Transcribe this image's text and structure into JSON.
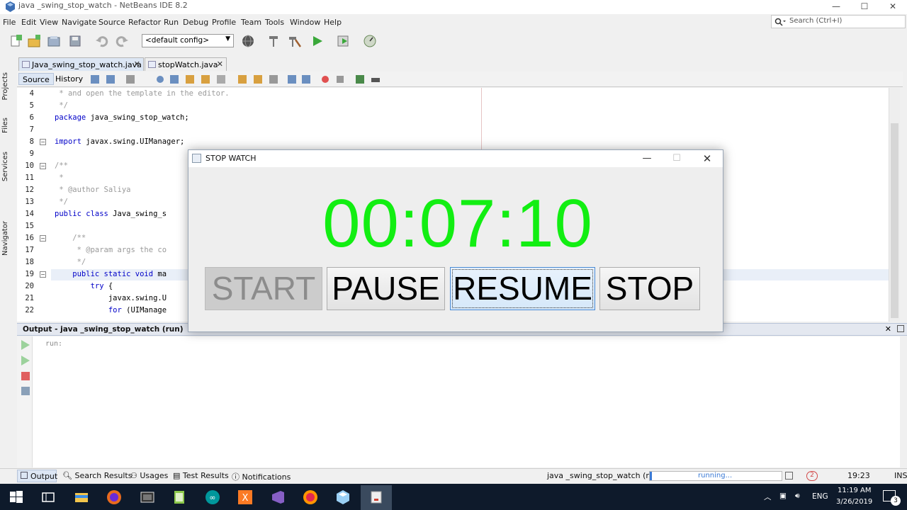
{
  "window": {
    "title": "java _swing_stop_watch - NetBeans IDE 8.2",
    "minimize": "—",
    "maximize": "☐",
    "close": "✕"
  },
  "menu": [
    "File",
    "Edit",
    "View",
    "Navigate",
    "Source",
    "Refactor",
    "Run",
    "Debug",
    "Profile",
    "Team",
    "Tools",
    "Window",
    "Help"
  ],
  "search": {
    "placeholder": "Search (Ctrl+I)"
  },
  "toolbar": {
    "config": "<default config>"
  },
  "side_tabs": [
    "Projects",
    "Files",
    "Services",
    "Navigator"
  ],
  "editor_tabs": [
    {
      "label": "Java_swing_stop_watch.java"
    },
    {
      "label": "stopWatch.java"
    }
  ],
  "source_tabs": {
    "source": "Source",
    "history": "History"
  },
  "code_lines": [
    {
      "n": "4",
      "text": " * and open the template in the editor.",
      "cls": "cmt"
    },
    {
      "n": "5",
      "text": " */",
      "cls": "cmt"
    },
    {
      "n": "6",
      "kw": "package",
      "text": " java_swing_stop_watch;"
    },
    {
      "n": "7",
      "text": ""
    },
    {
      "n": "8",
      "kw": "import",
      "text": " javax.swing.UIManager;"
    },
    {
      "n": "9",
      "text": ""
    },
    {
      "n": "10",
      "text": "/**",
      "cls": "cmt"
    },
    {
      "n": "11",
      "text": " *",
      "cls": "cmt"
    },
    {
      "n": "12",
      "text": " * @author Saliya",
      "cls": "cmt"
    },
    {
      "n": "13",
      "text": " */",
      "cls": "cmt"
    },
    {
      "n": "14",
      "kw": "public class",
      "text": " Java_swing_s"
    },
    {
      "n": "15",
      "text": ""
    },
    {
      "n": "16",
      "text": "    /**",
      "cls": "cmt"
    },
    {
      "n": "17",
      "text": "     * @param args the co",
      "cls": "cmt"
    },
    {
      "n": "18",
      "text": "     */",
      "cls": "cmt"
    },
    {
      "n": "19",
      "kw": "    public static void",
      "text": " ma"
    },
    {
      "n": "20",
      "kw": "        try",
      "text": " {"
    },
    {
      "n": "21",
      "text": "            javax.swing.U"
    },
    {
      "n": "22",
      "kw": "            for",
      "text": " (UIManage"
    }
  ],
  "output": {
    "header": "Output - java _swing_stop_watch (run)",
    "text": "run:",
    "close": "✕"
  },
  "status": {
    "tabs": [
      "Output",
      "Search Results",
      "Usages",
      "Test Results",
      "Notifications"
    ],
    "run_label": "java _swing_stop_watch (run)",
    "running": "running...",
    "position": "19:23",
    "ins": "INS",
    "errors": "2"
  },
  "taskbar": {
    "lang": "ENG",
    "time": "11:19 AM",
    "date": "3/26/2019",
    "notif": "3"
  },
  "stopwatch": {
    "title": "STOP WATCH",
    "display": "00:07:10",
    "start": "START",
    "pause": "PAUSE",
    "resume": "RESUME",
    "stop": "STOP",
    "display_color": "#12ee12"
  }
}
